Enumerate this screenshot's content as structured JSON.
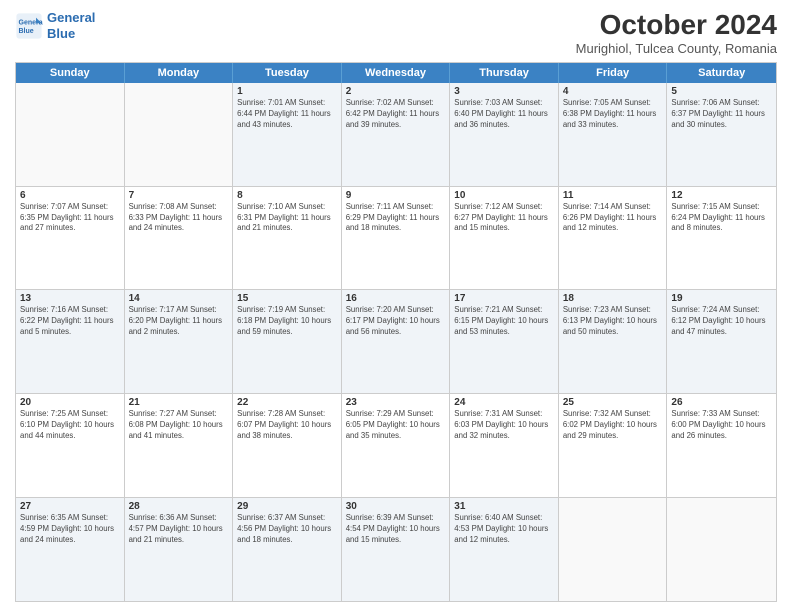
{
  "header": {
    "title": "October 2024",
    "subtitle": "Murighiol, Tulcea County, Romania",
    "logo_line1": "General",
    "logo_line2": "Blue"
  },
  "days_of_week": [
    "Sunday",
    "Monday",
    "Tuesday",
    "Wednesday",
    "Thursday",
    "Friday",
    "Saturday"
  ],
  "weeks": [
    [
      {
        "day": "",
        "detail": ""
      },
      {
        "day": "",
        "detail": ""
      },
      {
        "day": "1",
        "detail": "Sunrise: 7:01 AM\nSunset: 6:44 PM\nDaylight: 11 hours and 43 minutes."
      },
      {
        "day": "2",
        "detail": "Sunrise: 7:02 AM\nSunset: 6:42 PM\nDaylight: 11 hours and 39 minutes."
      },
      {
        "day": "3",
        "detail": "Sunrise: 7:03 AM\nSunset: 6:40 PM\nDaylight: 11 hours and 36 minutes."
      },
      {
        "day": "4",
        "detail": "Sunrise: 7:05 AM\nSunset: 6:38 PM\nDaylight: 11 hours and 33 minutes."
      },
      {
        "day": "5",
        "detail": "Sunrise: 7:06 AM\nSunset: 6:37 PM\nDaylight: 11 hours and 30 minutes."
      }
    ],
    [
      {
        "day": "6",
        "detail": "Sunrise: 7:07 AM\nSunset: 6:35 PM\nDaylight: 11 hours and 27 minutes."
      },
      {
        "day": "7",
        "detail": "Sunrise: 7:08 AM\nSunset: 6:33 PM\nDaylight: 11 hours and 24 minutes."
      },
      {
        "day": "8",
        "detail": "Sunrise: 7:10 AM\nSunset: 6:31 PM\nDaylight: 11 hours and 21 minutes."
      },
      {
        "day": "9",
        "detail": "Sunrise: 7:11 AM\nSunset: 6:29 PM\nDaylight: 11 hours and 18 minutes."
      },
      {
        "day": "10",
        "detail": "Sunrise: 7:12 AM\nSunset: 6:27 PM\nDaylight: 11 hours and 15 minutes."
      },
      {
        "day": "11",
        "detail": "Sunrise: 7:14 AM\nSunset: 6:26 PM\nDaylight: 11 hours and 12 minutes."
      },
      {
        "day": "12",
        "detail": "Sunrise: 7:15 AM\nSunset: 6:24 PM\nDaylight: 11 hours and 8 minutes."
      }
    ],
    [
      {
        "day": "13",
        "detail": "Sunrise: 7:16 AM\nSunset: 6:22 PM\nDaylight: 11 hours and 5 minutes."
      },
      {
        "day": "14",
        "detail": "Sunrise: 7:17 AM\nSunset: 6:20 PM\nDaylight: 11 hours and 2 minutes."
      },
      {
        "day": "15",
        "detail": "Sunrise: 7:19 AM\nSunset: 6:18 PM\nDaylight: 10 hours and 59 minutes."
      },
      {
        "day": "16",
        "detail": "Sunrise: 7:20 AM\nSunset: 6:17 PM\nDaylight: 10 hours and 56 minutes."
      },
      {
        "day": "17",
        "detail": "Sunrise: 7:21 AM\nSunset: 6:15 PM\nDaylight: 10 hours and 53 minutes."
      },
      {
        "day": "18",
        "detail": "Sunrise: 7:23 AM\nSunset: 6:13 PM\nDaylight: 10 hours and 50 minutes."
      },
      {
        "day": "19",
        "detail": "Sunrise: 7:24 AM\nSunset: 6:12 PM\nDaylight: 10 hours and 47 minutes."
      }
    ],
    [
      {
        "day": "20",
        "detail": "Sunrise: 7:25 AM\nSunset: 6:10 PM\nDaylight: 10 hours and 44 minutes."
      },
      {
        "day": "21",
        "detail": "Sunrise: 7:27 AM\nSunset: 6:08 PM\nDaylight: 10 hours and 41 minutes."
      },
      {
        "day": "22",
        "detail": "Sunrise: 7:28 AM\nSunset: 6:07 PM\nDaylight: 10 hours and 38 minutes."
      },
      {
        "day": "23",
        "detail": "Sunrise: 7:29 AM\nSunset: 6:05 PM\nDaylight: 10 hours and 35 minutes."
      },
      {
        "day": "24",
        "detail": "Sunrise: 7:31 AM\nSunset: 6:03 PM\nDaylight: 10 hours and 32 minutes."
      },
      {
        "day": "25",
        "detail": "Sunrise: 7:32 AM\nSunset: 6:02 PM\nDaylight: 10 hours and 29 minutes."
      },
      {
        "day": "26",
        "detail": "Sunrise: 7:33 AM\nSunset: 6:00 PM\nDaylight: 10 hours and 26 minutes."
      }
    ],
    [
      {
        "day": "27",
        "detail": "Sunrise: 6:35 AM\nSunset: 4:59 PM\nDaylight: 10 hours and 24 minutes."
      },
      {
        "day": "28",
        "detail": "Sunrise: 6:36 AM\nSunset: 4:57 PM\nDaylight: 10 hours and 21 minutes."
      },
      {
        "day": "29",
        "detail": "Sunrise: 6:37 AM\nSunset: 4:56 PM\nDaylight: 10 hours and 18 minutes."
      },
      {
        "day": "30",
        "detail": "Sunrise: 6:39 AM\nSunset: 4:54 PM\nDaylight: 10 hours and 15 minutes."
      },
      {
        "day": "31",
        "detail": "Sunrise: 6:40 AM\nSunset: 4:53 PM\nDaylight: 10 hours and 12 minutes."
      },
      {
        "day": "",
        "detail": ""
      },
      {
        "day": "",
        "detail": ""
      }
    ]
  ]
}
